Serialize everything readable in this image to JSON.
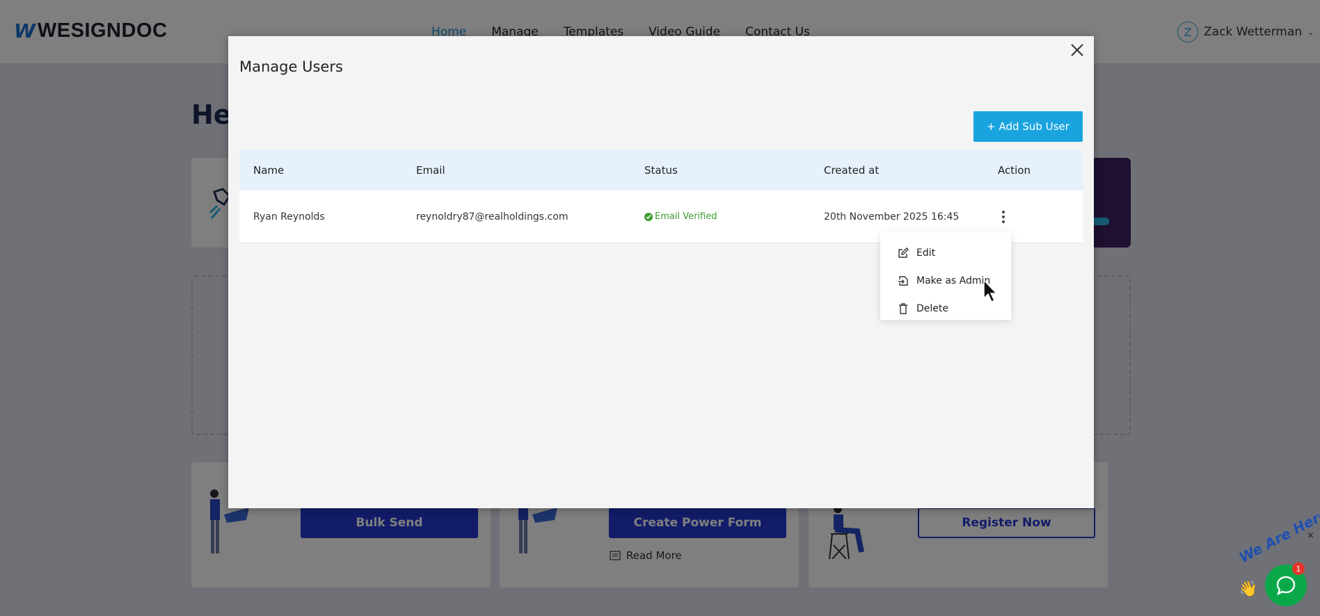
{
  "brand": {
    "logo_mark": "W",
    "logo_text": "WESIGNDOC"
  },
  "nav": {
    "items": [
      "Home",
      "Manage",
      "Templates",
      "Video Guide",
      "Contact Us"
    ]
  },
  "user": {
    "initial": "Z",
    "name": "Zack Wetterman"
  },
  "background": {
    "heading": "He",
    "buttons": {
      "bulk_send": "Bulk Send",
      "create_power_form": "Create Power Form",
      "register_now": "Register Now"
    },
    "read_more": "Read More"
  },
  "modal": {
    "title": "Manage Users",
    "add_button": "+ Add Sub User",
    "table": {
      "headers": {
        "name": "Name",
        "email": "Email",
        "status": "Status",
        "created_at": "Created at",
        "action": "Action"
      },
      "rows": [
        {
          "name": "Ryan Reynolds",
          "email": "reynoldry87@realholdings.com",
          "status": "Email Verified",
          "created_at": "20th November 2025 16:45"
        }
      ]
    },
    "action_menu": {
      "edit": "Edit",
      "make_admin": "Make as Admin",
      "delete": "Delete"
    }
  },
  "chat": {
    "label": "We Are Here!",
    "badge_count": "1",
    "close": "×"
  },
  "colors": {
    "accent": "#1aa4df",
    "primary_blue": "#2439d2",
    "verified_green": "#3a9d2e",
    "chat_green": "#0ba84a"
  }
}
